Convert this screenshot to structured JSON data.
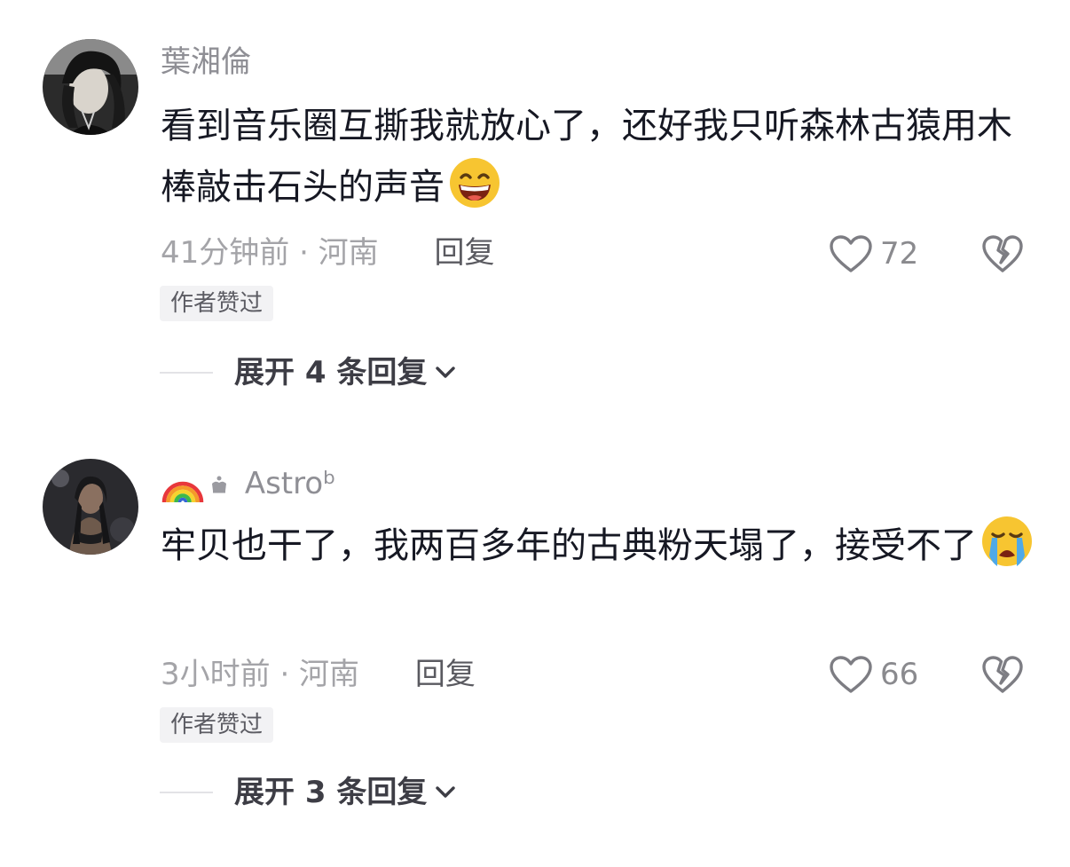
{
  "comments": [
    {
      "username": "葉湘倫",
      "content": "看到音乐圈互撕我就放心了，还好我只听森林古猿用木棒敲击石头的声音",
      "emoji": "grinning-face-emoji",
      "time_location": "41分钟前 · 河南",
      "reply_label": "回复",
      "likes": "72",
      "author_badge": "作者赞过",
      "expand_label": "展开 4 条回复"
    },
    {
      "username": "Astroᵇ",
      "username_badges": [
        "rainbow-icon",
        "crown-icon"
      ],
      "content": "牢贝也干了，我两百多年的古典粉天塌了，接受不了",
      "emoji": "loudly-crying-face-emoji",
      "time_location": "3小时前 · 河南",
      "reply_label": "回复",
      "likes": "66",
      "author_badge": "作者赞过",
      "expand_label": "展开 3 条回复"
    }
  ],
  "colors": {
    "text_primary": "#161823",
    "text_secondary": "#8f8f95",
    "badge_bg": "#f2f2f4"
  }
}
